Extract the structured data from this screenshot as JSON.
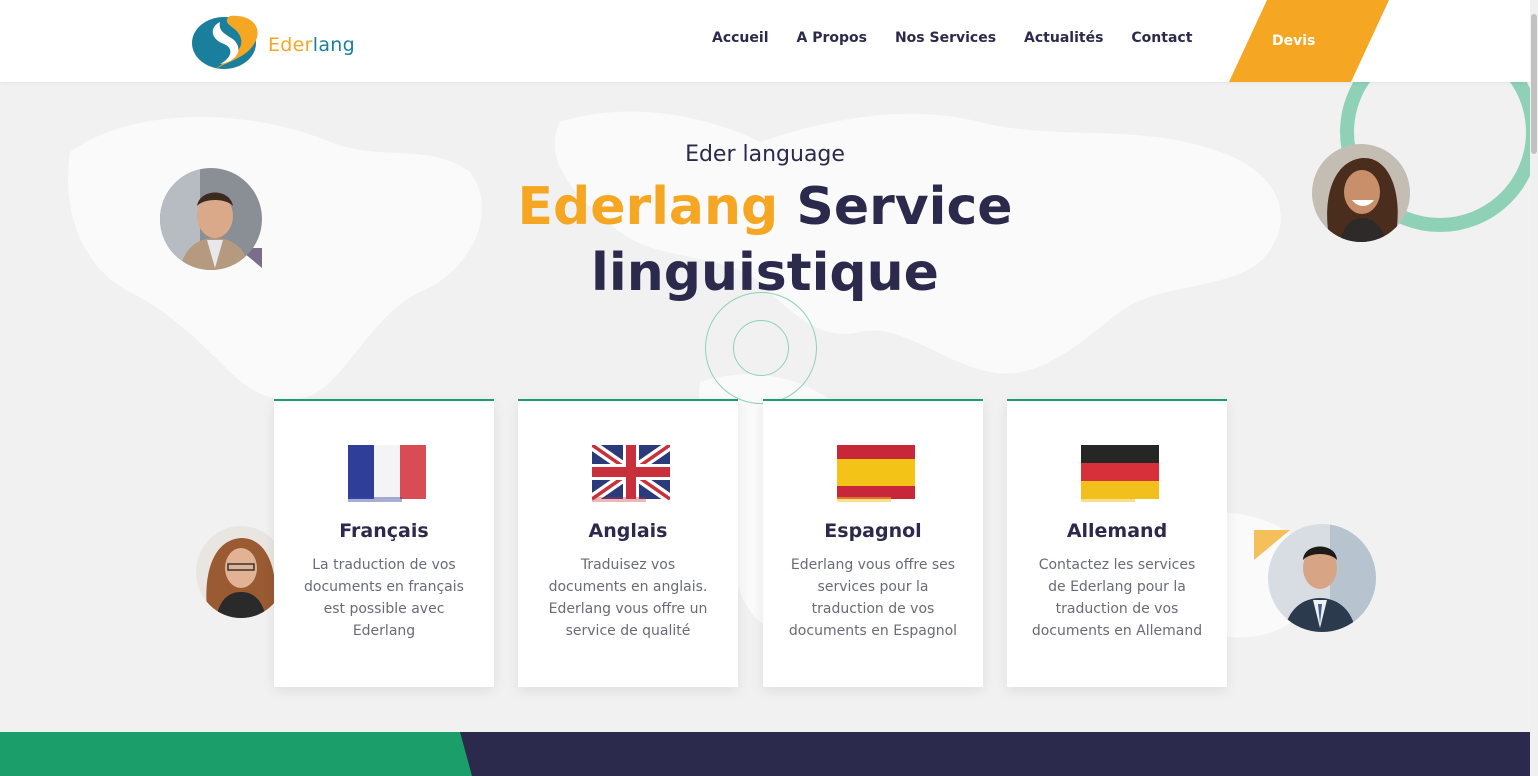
{
  "brand": {
    "logo_part1": "Eder",
    "logo_part2": "lang"
  },
  "nav": {
    "items": [
      "Accueil",
      "A Propos",
      "Nos Services",
      "Actualités",
      "Contact"
    ],
    "cta": "Devis"
  },
  "hero": {
    "pretitle": "Eder language",
    "title_highlight": "Ederlang",
    "title_rest_line1": " Service",
    "title_line2": "linguistique"
  },
  "cards": [
    {
      "title": "Français",
      "text": "La traduction de vos documents en français est possible avec Ederlang",
      "flag": "france-flag"
    },
    {
      "title": "Anglais",
      "text": "Traduisez vos documents en anglais. Ederlang vous offre un service de qualité",
      "flag": "uk-flag"
    },
    {
      "title": "Espagnol",
      "text": "Ederlang vous offre ses services pour la traduction de vos documents en Espagnol",
      "flag": "spain-flag"
    },
    {
      "title": "Allemand",
      "text": "Contactez les services de Ederlang pour la traduction de vos documents en Allemand",
      "flag": "germany-flag"
    }
  ],
  "colors": {
    "brand_orange": "#f5a623",
    "brand_navy": "#2b2a4c",
    "brand_green": "#1b9e6a",
    "brand_teal": "#1a7f9c"
  }
}
